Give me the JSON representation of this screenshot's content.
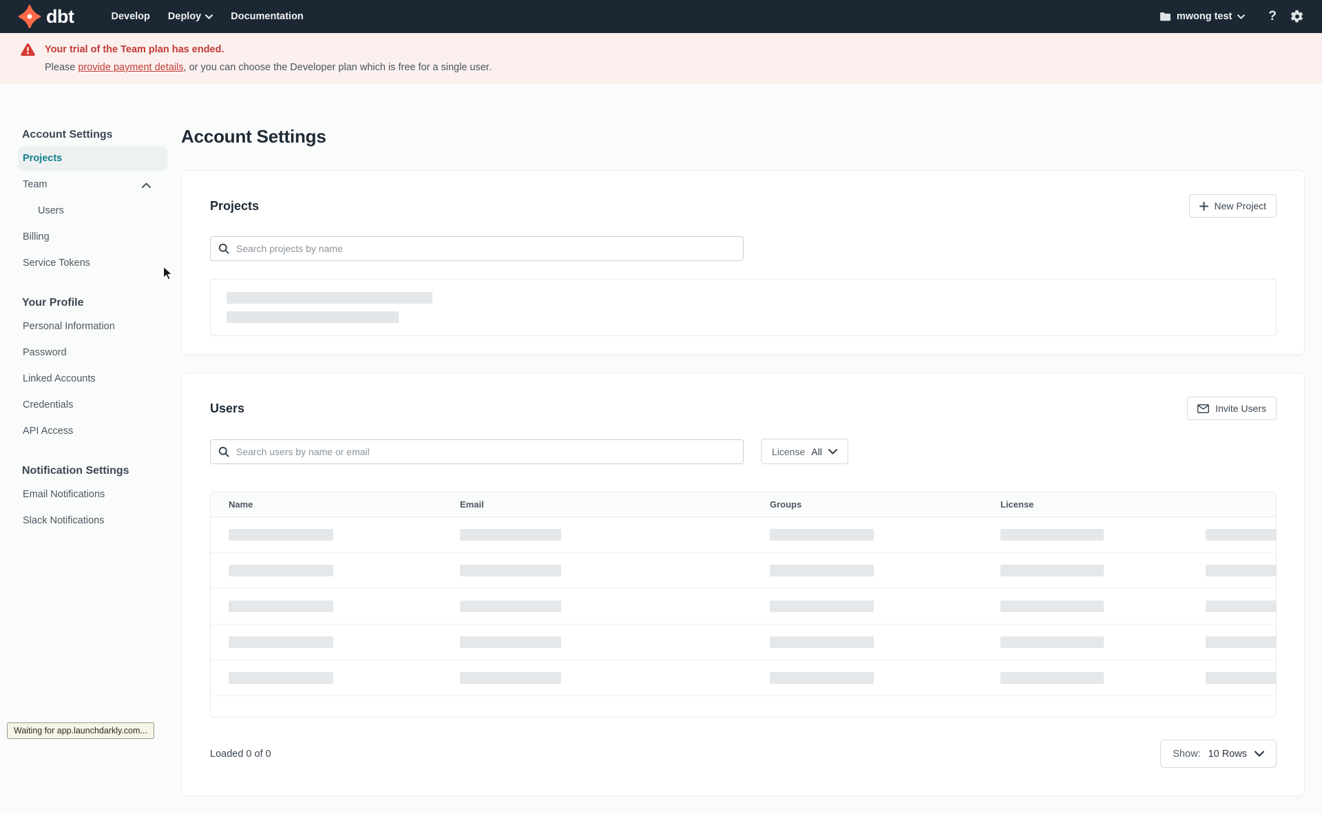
{
  "colors": {
    "nav_bg": "#1b2733",
    "brand_orange": "#ff694a",
    "accent_teal": "#13808b",
    "banner_bg": "#fbf0ee",
    "banner_red": "#c23b36",
    "page_bg": "#fafbfb",
    "skeleton_gray": "#e4e8ea"
  },
  "nav": {
    "logo": "dbt",
    "menu": [
      {
        "label": "Develop"
      },
      {
        "label": "Deploy"
      },
      {
        "label": "Documentation"
      }
    ],
    "account_label": "mwong test",
    "help_label": "?"
  },
  "banner": {
    "title": "Your trial of the Team plan has ended.",
    "body_prefix": "Please ",
    "link": "provide payment details",
    "body_suffix": ", or you can choose the Developer plan which is free for a single user."
  },
  "sidebar": {
    "sections": [
      {
        "heading": "Account Settings",
        "items": [
          {
            "label": "Projects"
          },
          {
            "label": "Team"
          },
          {
            "label": "Users"
          },
          {
            "label": "Billing"
          },
          {
            "label": "Service Tokens"
          }
        ]
      },
      {
        "heading": "Your Profile",
        "items": [
          {
            "label": "Personal Information"
          },
          {
            "label": "Password"
          },
          {
            "label": "Linked Accounts"
          },
          {
            "label": "Credentials"
          },
          {
            "label": "API Access"
          }
        ]
      },
      {
        "heading": "Notification Settings",
        "items": [
          {
            "label": "Email Notifications"
          },
          {
            "label": "Slack Notifications"
          }
        ]
      }
    ]
  },
  "main": {
    "page_title": "Account Settings",
    "projects": {
      "title": "Projects",
      "new_project_label": "New Project",
      "search_placeholder": "Search projects by name"
    },
    "users": {
      "title": "Users",
      "invite_label": "Invite Users",
      "search_placeholder": "Search users by name or email",
      "license_label": "License",
      "license_value": "All",
      "columns": [
        "Name",
        "Email",
        "Groups",
        "License"
      ],
      "skeleton_row_count": 5,
      "loaded_text": "Loaded 0 of 0",
      "show_label": "Show:",
      "show_value": "10 Rows"
    }
  },
  "status_bubble": "Waiting for app.launchdarkly.com..."
}
